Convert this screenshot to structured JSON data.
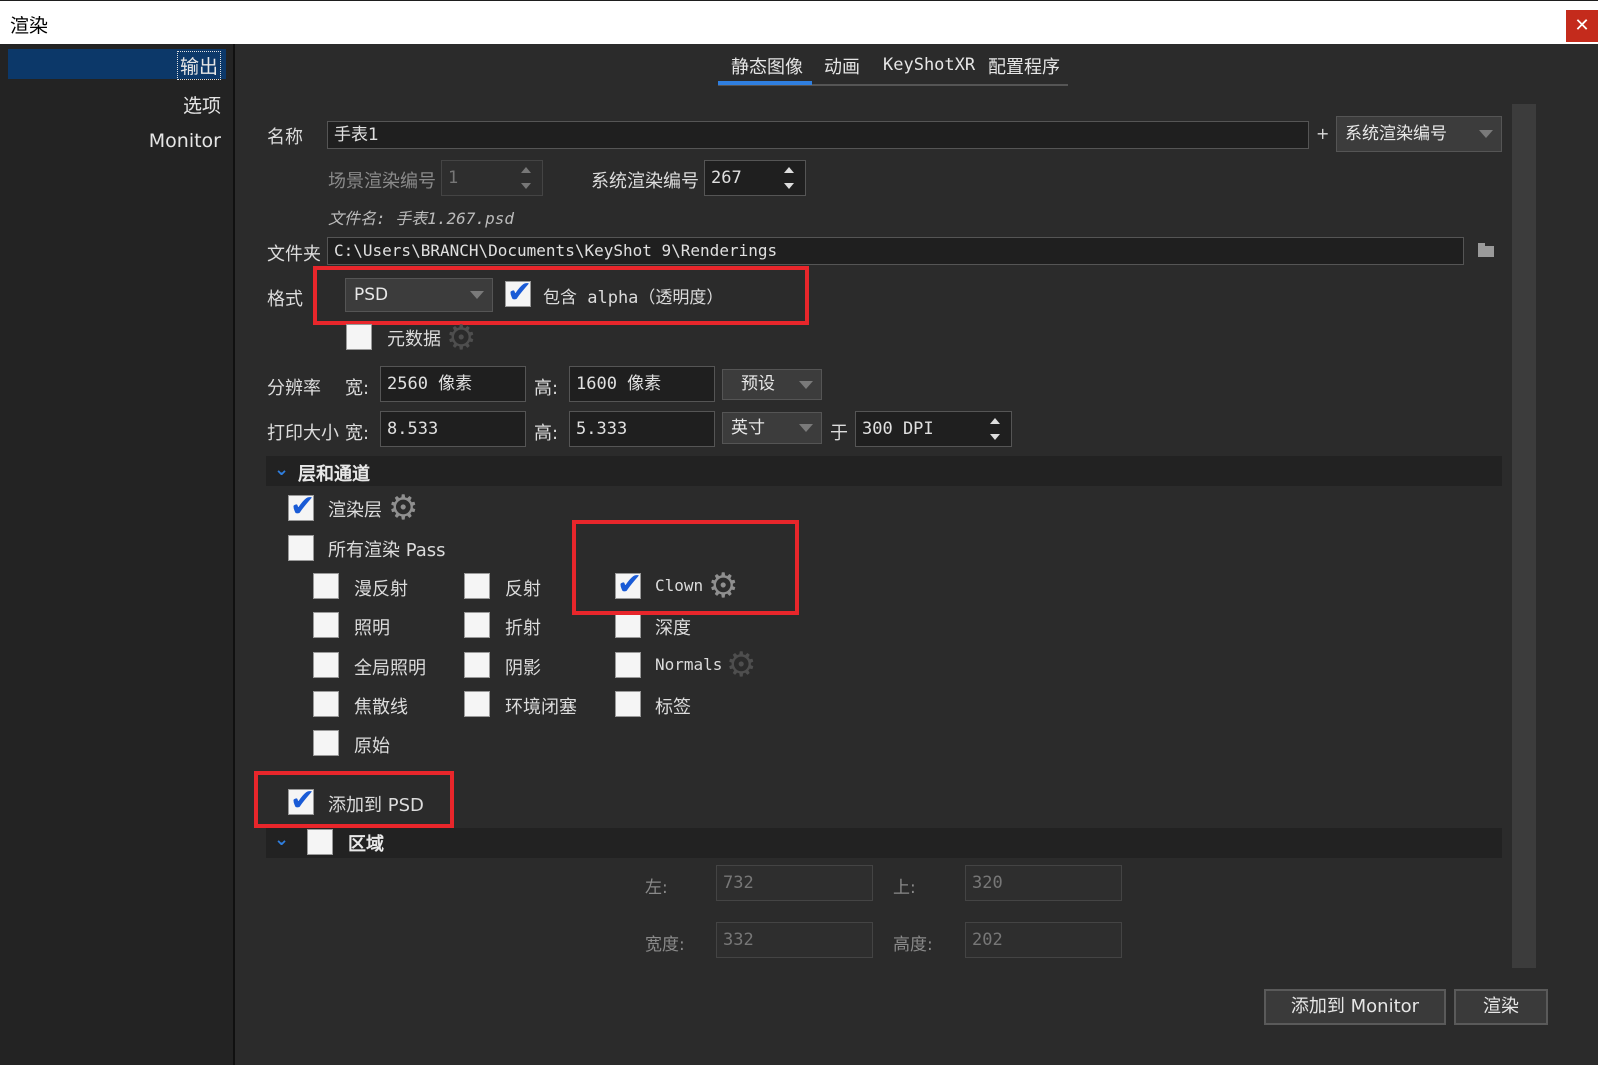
{
  "window": {
    "title": "渲染",
    "close_glyph": "✕"
  },
  "sidebar": {
    "items": [
      "输出",
      "选项",
      "Monitor"
    ]
  },
  "tabs": [
    "静态图像",
    "动画",
    "KeyShotXR",
    "配置程序"
  ],
  "name_label": "名称",
  "name_value": "手表1",
  "plus": "+",
  "name_suffix_select": "系统渲染编号",
  "scene_render_label": "场景渲染编号",
  "scene_render_value": "1",
  "system_render_label": "系统渲染编号",
  "system_render_value": "267",
  "filename_preview": "文件名: 手表1.267.psd",
  "folder_label": "文件夹",
  "folder_value": "C:\\Users\\BRANCH\\Documents\\KeyShot 9\\Renderings",
  "format_label": "格式",
  "format_value": "PSD",
  "alpha_label": "包含 alpha（透明度）",
  "metadata_label": "元数据",
  "resolution": {
    "label": "分辨率",
    "width_label": "宽:",
    "width_value": "2560 像素",
    "height_label": "高:",
    "height_value": "1600 像素",
    "preset": "预设"
  },
  "print_size": {
    "label": "打印大小",
    "width_label": "宽:",
    "width_value": "8.533",
    "height_label": "高:",
    "height_value": "5.333",
    "unit": "英寸",
    "at_label": "于",
    "dpi_value": "300 DPI"
  },
  "layers": {
    "title": "层和通道",
    "render_layers": "渲染层",
    "all_passes": "所有渲染 Pass",
    "col1": [
      "漫反射",
      "照明",
      "全局照明",
      "焦散线",
      "原始"
    ],
    "col2": [
      "反射",
      "折射",
      "阴影",
      "环境闭塞"
    ],
    "col3": [
      "Clown",
      "深度",
      "Normals",
      "标签"
    ]
  },
  "add_to_psd": "添加到 PSD",
  "region": {
    "title": "区域",
    "left_label": "左:",
    "left_value": "732",
    "top_label": "上:",
    "top_value": "320",
    "width_label": "宽度:",
    "width_value": "332",
    "height_label": "高度:",
    "height_value": "202"
  },
  "buttons": {
    "add_monitor": "添加到 Monitor",
    "render": "渲染"
  },
  "colors": {
    "accent": "#2f7fe0",
    "highlight": "#e8262b",
    "selection": "#0c3869"
  }
}
